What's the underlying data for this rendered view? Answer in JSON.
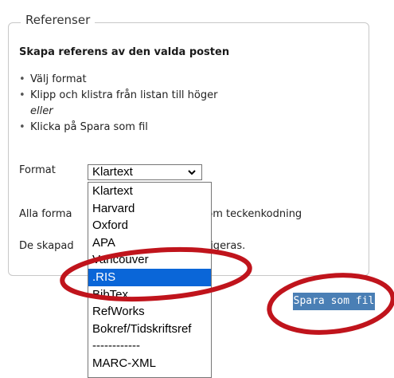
{
  "panel": {
    "legend": "Referenser",
    "heading": "Skapa referens av den valda posten",
    "steps": [
      "Välj format",
      "Klipp och klistra från listan till höger",
      "Klicka på Spara som fil"
    ],
    "or_text": "eller",
    "format_label": "Format",
    "note1_start": "Alla forma",
    "note1_end": "som teckenkodning",
    "note2_start": "De skapad",
    "note2_end": "behöva redigeras."
  },
  "format_select": {
    "selected": "Klartext",
    "highlighted": ".RIS",
    "options": [
      "Klartext",
      "Harvard",
      "Oxford",
      "APA",
      "Vancouver",
      ".RIS",
      "BibTex",
      "RefWorks",
      "Bokref/Tidskriftsref",
      "------------",
      "MARC-XML"
    ]
  },
  "save_button": {
    "label": "Spara som fil"
  },
  "colors": {
    "highlight": "#0a66d8",
    "save_button_bg": "#4a7fb5",
    "annotation_ellipse": "#c0141c"
  }
}
